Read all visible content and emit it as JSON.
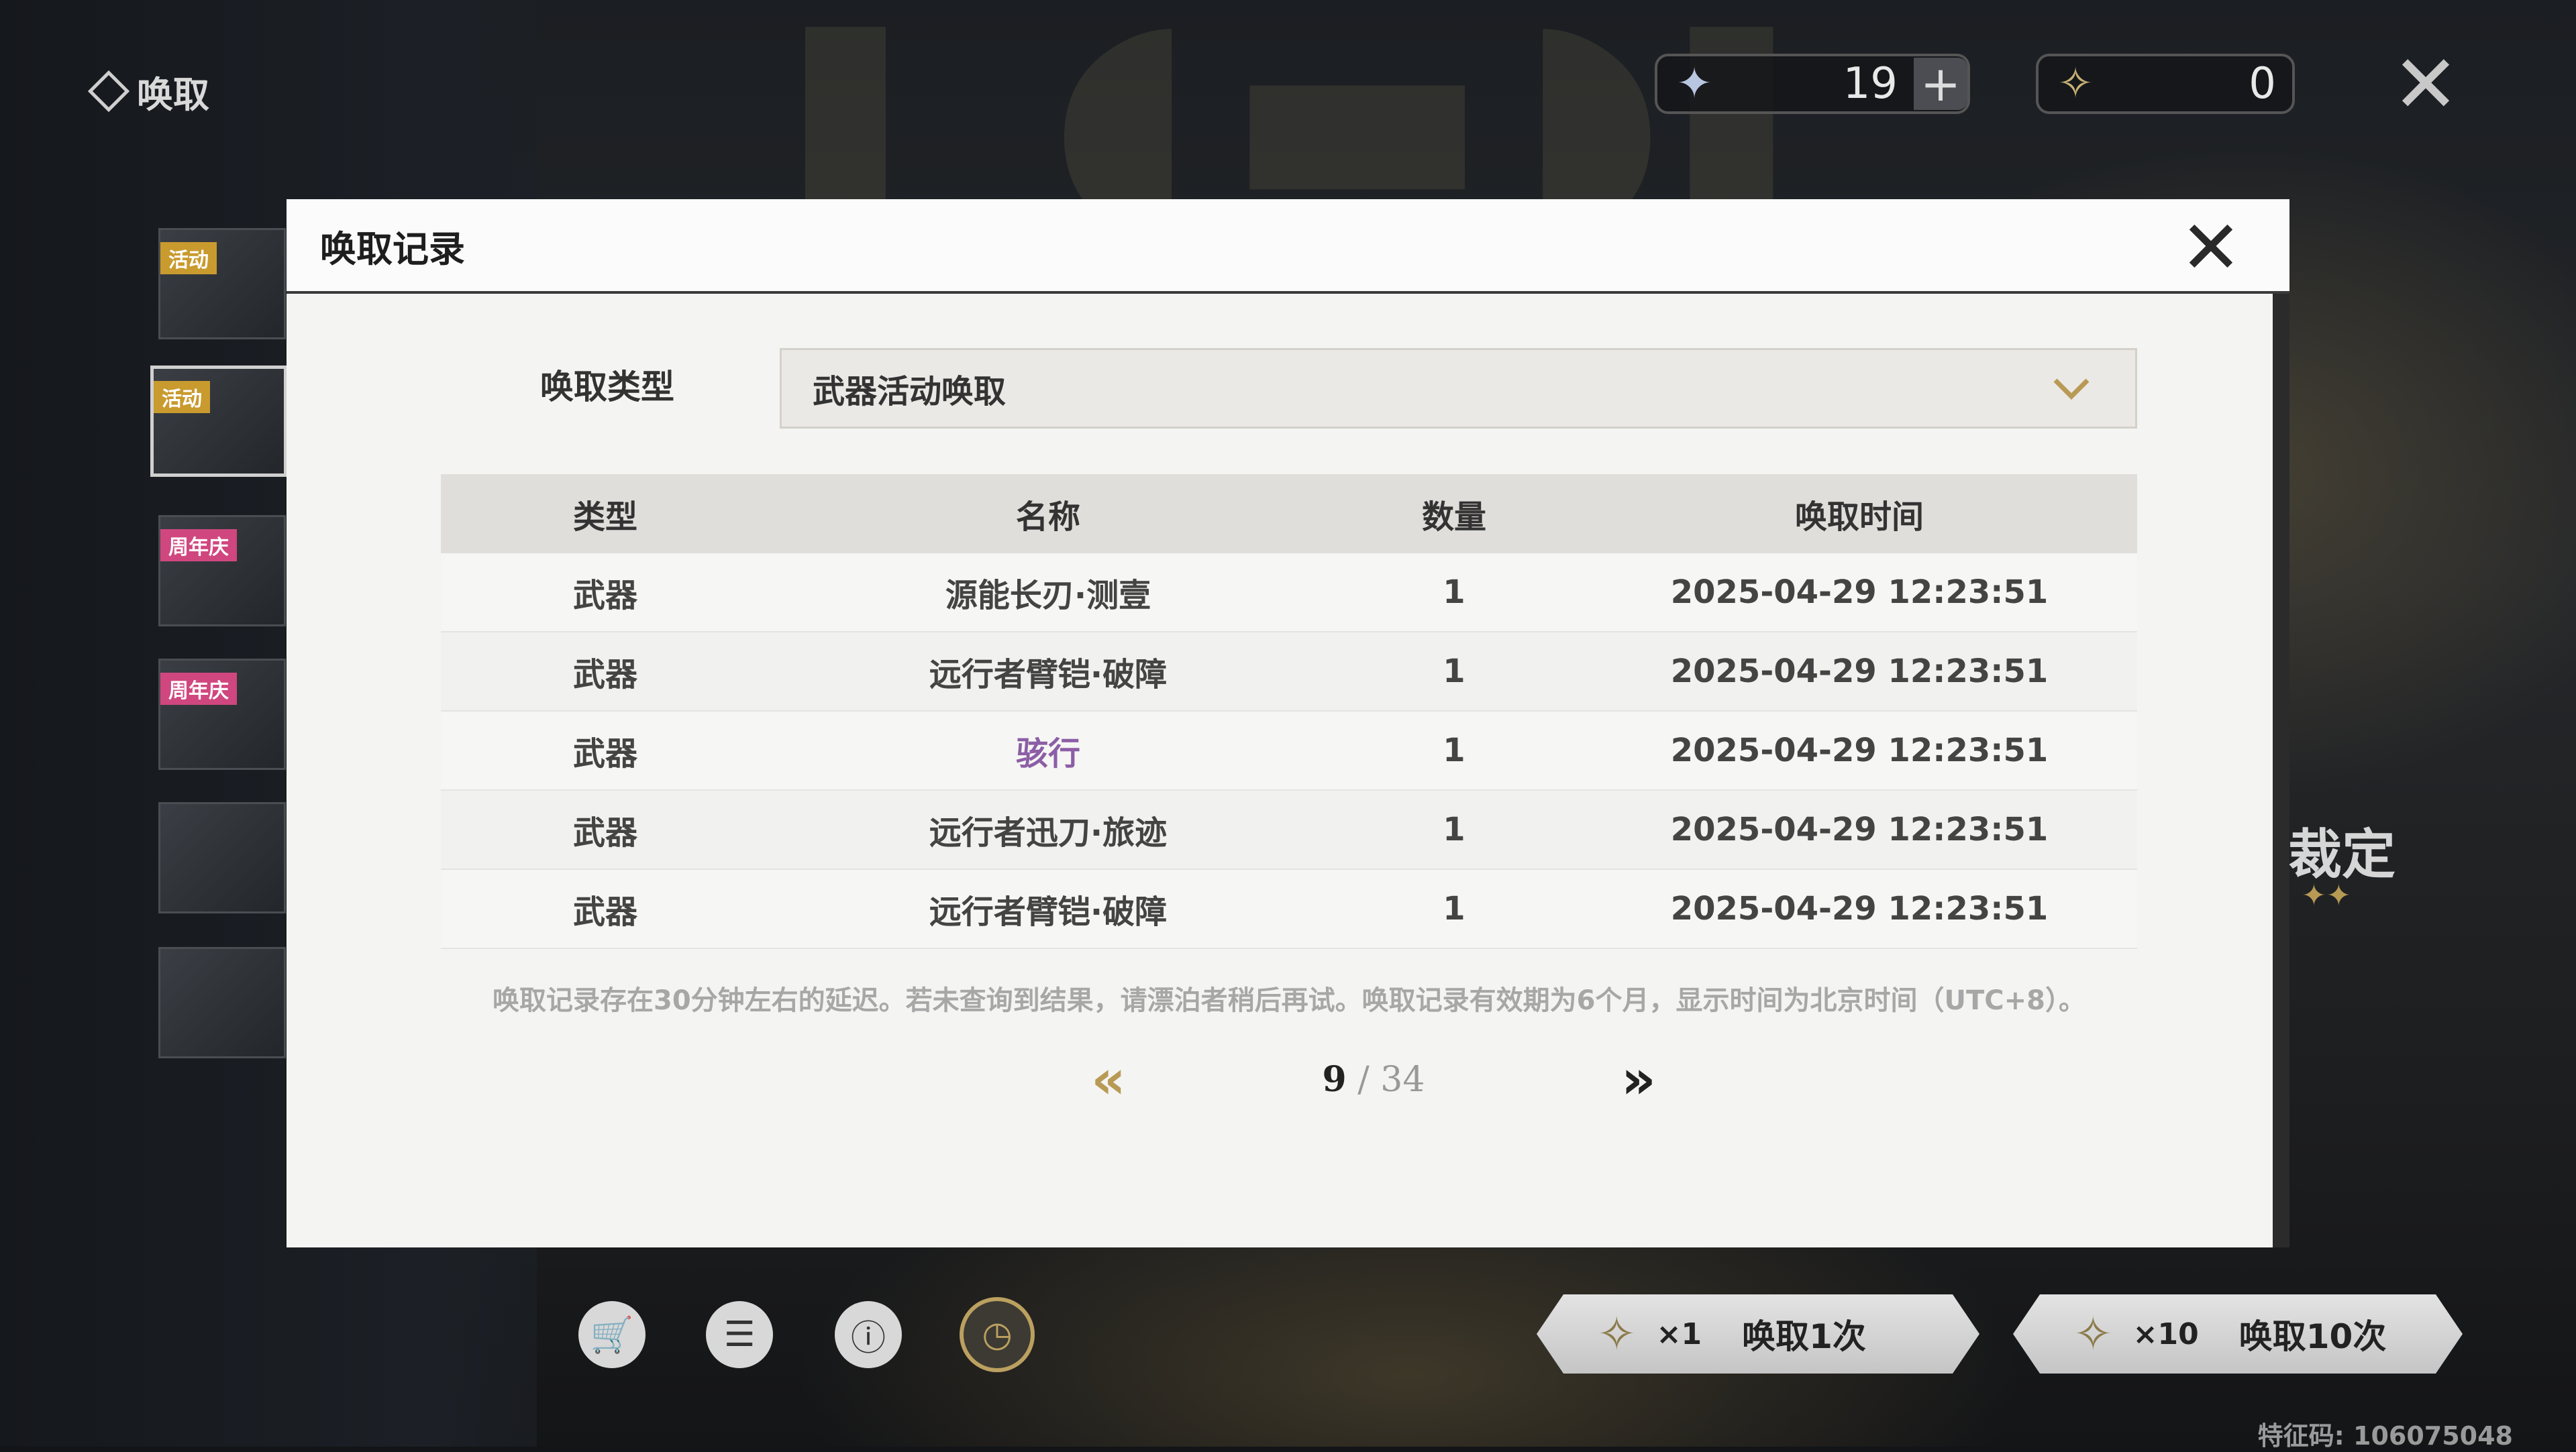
{
  "screen": {
    "title": "唤取",
    "feature_code": "特征码: 106075048",
    "right_label": "裁定",
    "right_stars": "✦✦"
  },
  "currency": {
    "astrite_icon": "astrite-star-icon",
    "astrite_value": "19",
    "plus_label": "+",
    "tide_icon": "forging-tide-icon",
    "tide_value": "0"
  },
  "sidebar": {
    "cards": [
      {
        "tag": "活动",
        "tag_color": "#c99a2e"
      },
      {
        "tag": "活动",
        "tag_color": "#c99a2e"
      },
      {
        "tag": "周年庆",
        "tag_color": "#d0477f"
      },
      {
        "tag": "周年庆",
        "tag_color": "#d0477f"
      },
      {
        "tag": ""
      },
      {
        "tag": ""
      }
    ]
  },
  "bottom_bar": {
    "icons": [
      "shop-cart-icon",
      "details-icon",
      "info-icon",
      "history-clock-icon"
    ],
    "summon_1": {
      "mult": "×1",
      "label": "唤取1次"
    },
    "summon_10": {
      "mult": "×10",
      "label": "唤取10次"
    }
  },
  "modal": {
    "title": "唤取记录",
    "filter_label": "唤取类型",
    "filter_value": "武器活动唤取",
    "columns": [
      "类型",
      "名称",
      "数量",
      "唤取时间"
    ],
    "rows": [
      {
        "type": "武器",
        "name": "源能长刃·测壹",
        "qty": "1",
        "time": "2025-04-29 12:23:51",
        "highlight": false
      },
      {
        "type": "武器",
        "name": "远行者臂铠·破障",
        "qty": "1",
        "time": "2025-04-29 12:23:51",
        "highlight": false
      },
      {
        "type": "武器",
        "name": "骇行",
        "qty": "1",
        "time": "2025-04-29 12:23:51",
        "highlight": true
      },
      {
        "type": "武器",
        "name": "远行者迅刀·旅迹",
        "qty": "1",
        "time": "2025-04-29 12:23:51",
        "highlight": false
      },
      {
        "type": "武器",
        "name": "远行者臂铠·破障",
        "qty": "1",
        "time": "2025-04-29 12:23:51",
        "highlight": false
      }
    ],
    "note": "唤取记录存在30分钟左右的延迟。若未查询到结果，请漂泊者稍后再试。唤取记录有效期为6个月，显示时间为北京时间（UTC+8）。",
    "pager": {
      "current": "9",
      "separator": " / ",
      "total": "34"
    },
    "colors": {
      "accent_gold": "#b89a55",
      "highlight_purple": "#8c5ea6"
    }
  }
}
